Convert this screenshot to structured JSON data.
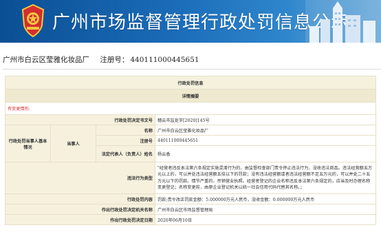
{
  "banner": {
    "title": "广州市场监督管理行政处罚信息公示"
  },
  "company": {
    "name": "广州市白云区莹雅化妆品厂",
    "reg_label": "注册号：",
    "reg_no": "440111000445651"
  },
  "table": {
    "section_title": "行政处罚信息",
    "sub_title": "详情摘要",
    "changed_note": "有变更情形:",
    "rows": {
      "doc_no_label": "行政处罚决定书文号",
      "doc_no": "穗云市监处字[2020]145号",
      "party_label": "行政处罚当事人基本情况",
      "party_type": "当事人",
      "name_label": "名称",
      "name": "广州市白云区莹雅化妆品厂",
      "reg_label": "注册号",
      "reg": "440111000445651",
      "rep_label": "法定代表人（负责人）姓名",
      "rep": "杨云香",
      "type_label": "违法行为类型",
      "type": "\"经营者违反本法第六条规定实施混淆行为的，由监督检查部门责令停止违法行为，没收违法商品。违法经营额五万元以上的，可以并处违法经营额五倍以下的罚款；没有违法经营额或者违法经营额不足五万元的，可以并处二十五万元以下的罚款。情节严重的，吊销营业执照。经营者登记的企业名称违反本法第六条规定的，应当及时办理名称变更登记；名称变更前，由原企业登记机关以统一社会信用代码代替其名称。；",
      "content_label": "行政处罚内容",
      "content": "罚款;责令改正罚款金额：5.000000万元人民币，没收金额：0.000000万元人民币",
      "org_label": "作出行政处罚决定机关名称",
      "org": "广州市白云区市场监督管理局",
      "date_label": "作出行政处罚决定日期",
      "date": "2020年06月10日"
    }
  }
}
